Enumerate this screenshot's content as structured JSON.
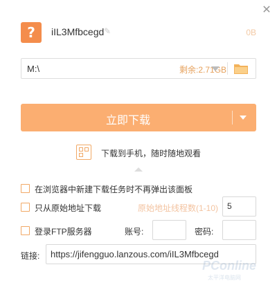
{
  "file": {
    "icon_glyph": "?",
    "name": "iIL3Mfbcegd",
    "edit_glyph": "✎",
    "size": "0B"
  },
  "path": {
    "value": "M:\\",
    "remaining": "剩余:2.71GB"
  },
  "download": {
    "label": "立即下载"
  },
  "phone": {
    "text": "下载到手机，随时随地观看"
  },
  "options": {
    "no_popup": "在浏览器中新建下载任务时不再弹出该面板",
    "origin_only": "只从原始地址下载",
    "thread_label": "原始地址线程数(1-10)",
    "thread_value": "5",
    "ftp": "登录FTP服务器",
    "account_label": "账号:",
    "password_label": "密码:"
  },
  "link": {
    "label": "链接:",
    "value": "https://jifengguo.lanzous.com/iIL3Mfbcegd"
  },
  "watermark": {
    "main": "PConline",
    "sub": "太平洋电脑网"
  },
  "colors": {
    "accent": "#fbae71",
    "checkbox_border": "#f1a865",
    "remaining_text": "#e6a15c"
  },
  "icons": {
    "close": "close-icon",
    "file": "question-file-icon",
    "folder": "folder-icon",
    "qr": "qr-code-icon"
  }
}
